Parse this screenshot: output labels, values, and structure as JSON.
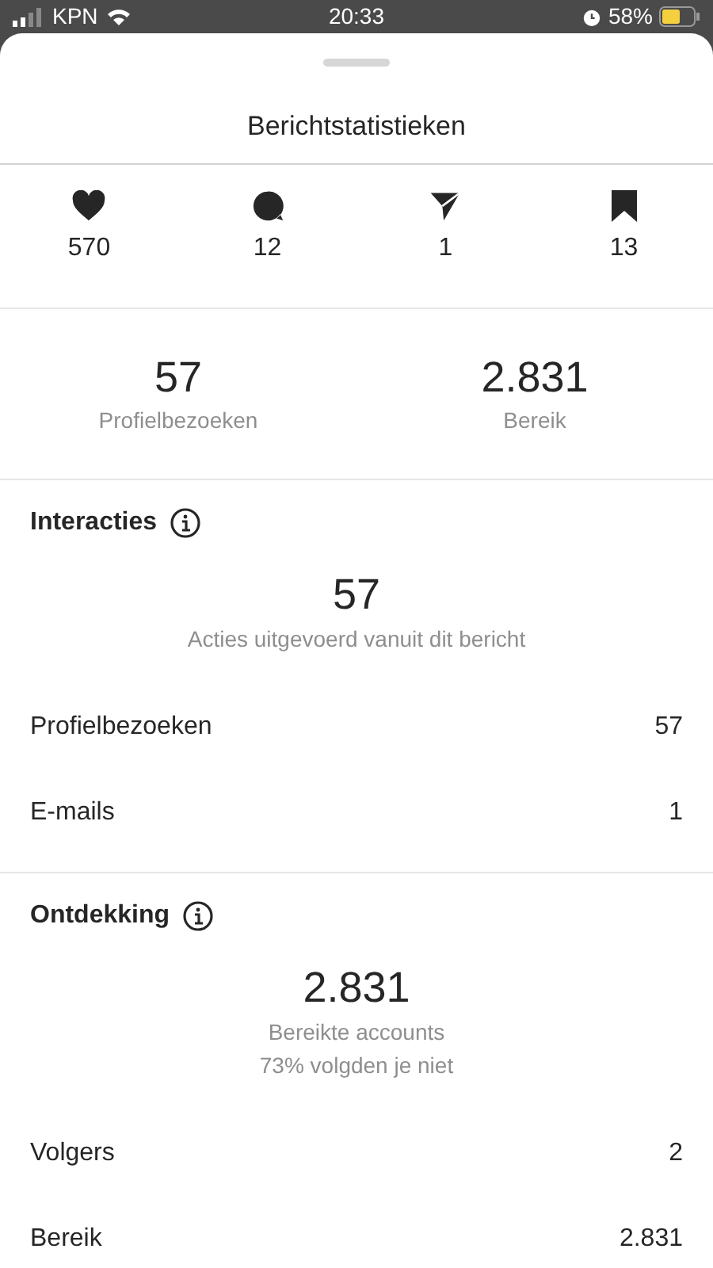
{
  "status_bar": {
    "carrier": "KPN",
    "time": "20:33",
    "battery": "58%"
  },
  "title": "Berichtstatistieken",
  "engagement": [
    {
      "kind": "like",
      "value": "570"
    },
    {
      "kind": "comment",
      "value": "12"
    },
    {
      "kind": "share",
      "value": "1"
    },
    {
      "kind": "save",
      "value": "13"
    }
  ],
  "summary": [
    {
      "value": "57",
      "label": "Profielbezoeken"
    },
    {
      "value": "2.831",
      "label": "Bereik"
    }
  ],
  "sections": [
    {
      "title": "Interacties",
      "total": "57",
      "captions": [
        "Acties uitgevoerd vanuit dit bericht"
      ],
      "rows": [
        {
          "label": "Profielbezoeken",
          "value": "57"
        },
        {
          "label": "E-mails",
          "value": "1"
        }
      ]
    },
    {
      "title": "Ontdekking",
      "total": "2.831",
      "captions": [
        "Bereikte accounts",
        "73% volgden je niet"
      ],
      "rows": [
        {
          "label": "Volgers",
          "value": "2"
        },
        {
          "label": "Bereik",
          "value": "2.831"
        }
      ]
    }
  ]
}
